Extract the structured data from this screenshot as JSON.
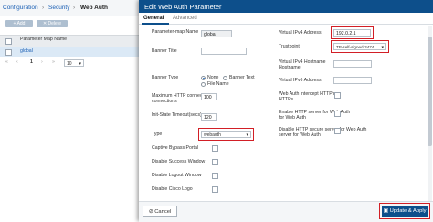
{
  "breadcrumb": {
    "configuration": "Configuration",
    "security": "Security",
    "current": "Web Auth",
    "sep1": "›",
    "sep2": "›"
  },
  "background": {
    "add_label": "+ Add",
    "delete_label": "✕ Delete",
    "column_header": "Parameter Map Name",
    "row_value": "global",
    "pager_first": "«",
    "pager_prev": "‹",
    "page_number": "1",
    "pager_next": "›",
    "pager_last": "»",
    "page_size": "10"
  },
  "modal": {
    "title": "Edit Web Auth Parameter",
    "tabs": [
      "General",
      "Advanced"
    ],
    "left": {
      "param_map_name_label": "Parameter-map Name",
      "param_map_name_value": "global",
      "banner_title_label": "Banner Title",
      "banner_type_label": "Banner Type",
      "banner_none": "None",
      "banner_text": "Banner Text",
      "banner_file": "File Name",
      "max_http_label": "Maximum HTTP connections",
      "max_http_value": "100",
      "init_state_label": "Init-State Timeout(secs)",
      "init_state_value": "120",
      "type_label": "Type",
      "type_value": "webauth",
      "captive_bypass_label": "Captive Bypass Portal",
      "disable_success_label": "Disable Success Window",
      "disable_logout_label": "Disable Logout Window",
      "disable_cisco_logo_label": "Disable Cisco Logo"
    },
    "right": {
      "virtual_ipv4_label": "Virtual IPv4 Address",
      "virtual_ipv4_value": "192.0.2.1",
      "trustpoint_label": "Trustpoint",
      "trustpoint_value": "TP-self-signed-3474",
      "virtual_ipv4_host_label": "Virtual IPv4 Hostname",
      "virtual_ipv6_label": "Virtual IPv6 Address",
      "intercept_https_label": "Web Auth intercept HTTPs",
      "enable_http_label": "Enable HTTP server for Web Auth",
      "disable_http_secure_label": "Disable HTTP secure server for Web Auth"
    },
    "cancel_label": "Cancel",
    "apply_label": "Update & Apply"
  },
  "colors": {
    "header": "#0d4f8b",
    "highlight": "#d21f26",
    "link": "#1a5fb4"
  }
}
